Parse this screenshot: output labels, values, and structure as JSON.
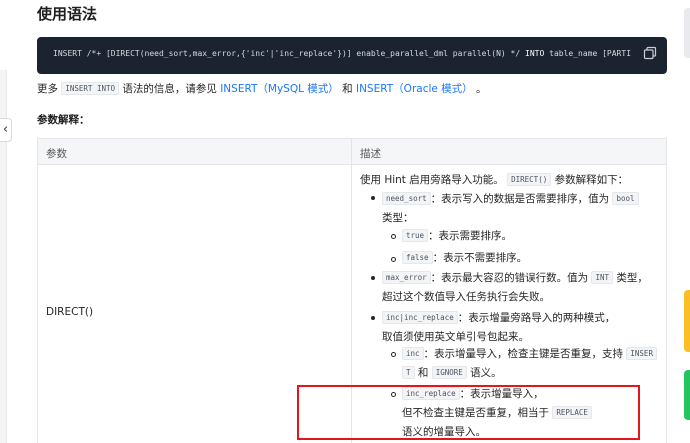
{
  "section_title": "使用语法",
  "code": {
    "prefix": "INSERT /*+ [DIRECT(need_sort,max_error,{'inc'|'inc_replace'})] enable_parallel_dml parallel(N) */",
    "into": "INTO",
    "rest": "table_name [PARTI"
  },
  "more_info": {
    "prefix": "更多",
    "code": "INSERT INTO",
    "middle": "语法的信息，请参见",
    "link_mysql": "INSERT（MySQL 模式）",
    "and": "和",
    "link_oracle": "INSERT（Oracle 模式）",
    "end": "。"
  },
  "param_title": "参数解释：",
  "table": {
    "headers": [
      "参数",
      "描述"
    ],
    "param": "DIRECT()",
    "desc_intro_text": "使用 Hint 启用旁路导入功能。",
    "desc_intro_code": "DIRECT()",
    "desc_intro_tail": "参数解释如下：",
    "need_sort": {
      "code": "need_sort",
      "text": "：表示写入的数据是否需要排序，值为",
      "type_code": "bool",
      "line2": "类型："
    },
    "true_item": {
      "code": "true",
      "text": "：表示需要排序。"
    },
    "false_item": {
      "code": "false",
      "text": "：表示不需要排序。"
    },
    "max_error": {
      "code": "max_error",
      "text": "：表示最大容忍的错误行数。值为",
      "type_code": "INT",
      "type_tail": "类型，",
      "line2": "超过这个数值导入任务执行会失败。"
    },
    "inc_mode": {
      "code": "inc|inc_replace",
      "text": "：表示增量旁路导入的两种模式，",
      "line2": "取值须使用英文单引号包起来。"
    },
    "inc_item": {
      "code": "inc",
      "text": "：表示增量导入，检查主键是否重复，支持",
      "code2a": "INSER",
      "code2b": "T",
      "and": "和",
      "code3": "IGNORE",
      "tail": "语义。"
    },
    "inc_replace_item": {
      "code": "inc_replace",
      "text": "：表示增量导入，",
      "line2": "但不检查主键是否重复，相当于",
      "code2": "REPLACE",
      "line3": "语义的增量导入。"
    }
  }
}
